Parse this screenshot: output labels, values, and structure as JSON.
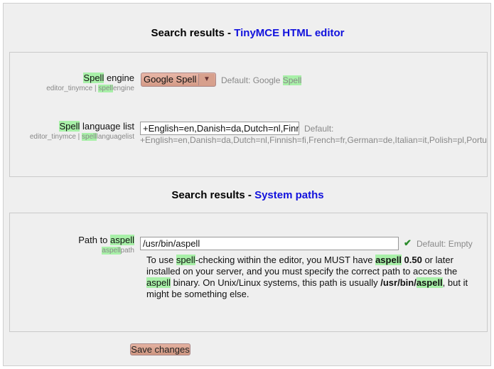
{
  "section1": {
    "title_prefix": "Search results - ",
    "title_link": "TinyMCE HTML editor"
  },
  "spell_engine": {
    "label_hl": "Spell",
    "label_rest": " engine",
    "sub_prefix": "editor_tinymce | ",
    "sub_hl": "spell",
    "sub_rest": "engine",
    "select_value": "Google Spell",
    "default_prefix": "Default: Google ",
    "default_hl": "Spell"
  },
  "spell_lang": {
    "label_hl": "Spell",
    "label_rest": " language list",
    "sub_prefix": "editor_tinymce | ",
    "sub_hl": "spell",
    "sub_rest": "languagelist",
    "input_value": "+English=en,Danish=da,Dutch=nl,Finnish=fi,French=fr,German=de,Italian=it,Polish=pl,Portuguese=pt,Spanish=es,Swedish=sv",
    "default_label": "Default:",
    "default_value": "+English=en,Danish=da,Dutch=nl,Finnish=fi,French=fr,German=de,Italian=it,Polish=pl,Portuguese=pt,Spanish=es,Swedish=sv"
  },
  "section2": {
    "title_prefix": "Search results - ",
    "title_link": "System paths"
  },
  "aspell_path": {
    "label_prefix": "Path to ",
    "label_hl": "aspell",
    "sub_hl": "aspell",
    "sub_rest": "path",
    "input_value": "/usr/bin/aspell",
    "default_text": "Default: Empty",
    "desc": {
      "p1": "To use ",
      "p1_hl": "spell",
      "p2": "-checking within the editor, you MUST have ",
      "p2_hl": "aspell",
      "p3": " 0.50",
      "p4": " or later installed on your server, and you must specify the correct path to access the ",
      "p4_hl": "aspell",
      "p5": " binary. On Unix/Linux systems, this path is usually ",
      "p5_b": "/usr/bin/",
      "p5_bhl": "aspell",
      "p6": ", but it might be something else."
    }
  },
  "save_label": "Save changes",
  "colors": {
    "highlight": "#a8f0a8",
    "link": "#1111dd",
    "button": "#d49a86"
  },
  "icons": {
    "check": "check-icon",
    "dropdown": "dropdown-arrow-icon"
  }
}
